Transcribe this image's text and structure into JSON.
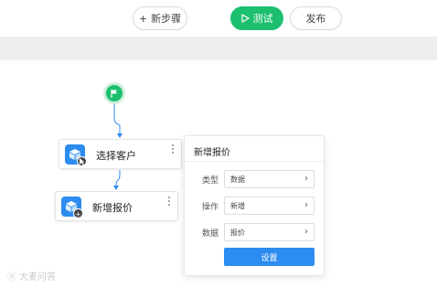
{
  "toolbar": {
    "new_step_label": "新步骤",
    "test_label": "测试",
    "publish_label": "发布"
  },
  "nodes": [
    {
      "label": "选择客户",
      "icon": "cube-icon",
      "badge_icon": "cursor-icon"
    },
    {
      "label": "新增报价",
      "icon": "cube-icon",
      "badge_icon": "plus-icon"
    }
  ],
  "panel": {
    "title": "新增报价",
    "rows": [
      {
        "label": "类型",
        "value": "数据"
      },
      {
        "label": "操作",
        "value": "新增"
      },
      {
        "label": "数据",
        "value": "报价"
      }
    ],
    "submit_label": "设置"
  },
  "watermark": "大麦问答",
  "colors": {
    "accent_green": "#1cbf6e",
    "accent_blue": "#2d8cf0",
    "band_grey": "#eeeeee"
  }
}
